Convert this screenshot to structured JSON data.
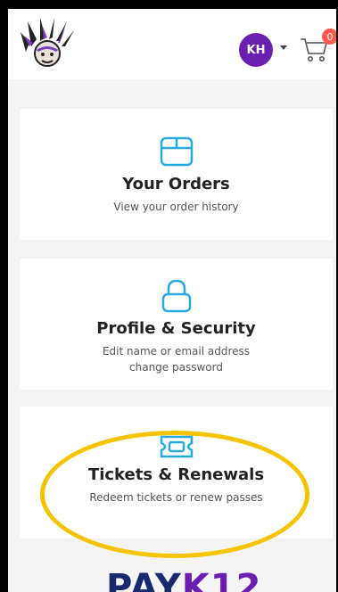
{
  "header": {
    "avatar_initials": "KH",
    "cart_count": "0"
  },
  "cards": [
    {
      "title": "Your Orders",
      "desc_lines": [
        "View your order history"
      ],
      "icon": "box-icon"
    },
    {
      "title": "Profile & Security",
      "desc_lines": [
        "Edit name or email address",
        "change password"
      ],
      "icon": "lock-icon"
    },
    {
      "title": "Tickets & Renewals",
      "desc_lines": [
        "Redeem tickets or renew passes"
      ],
      "icon": "ticket-icon"
    }
  ],
  "footer": {
    "brand_a": "PAY",
    "brand_b": "K12"
  },
  "colors": {
    "accent": "#29a9e0",
    "avatar": "#6a1fb0",
    "badge": "#ff5a4e",
    "highlight": "#f5c400"
  }
}
